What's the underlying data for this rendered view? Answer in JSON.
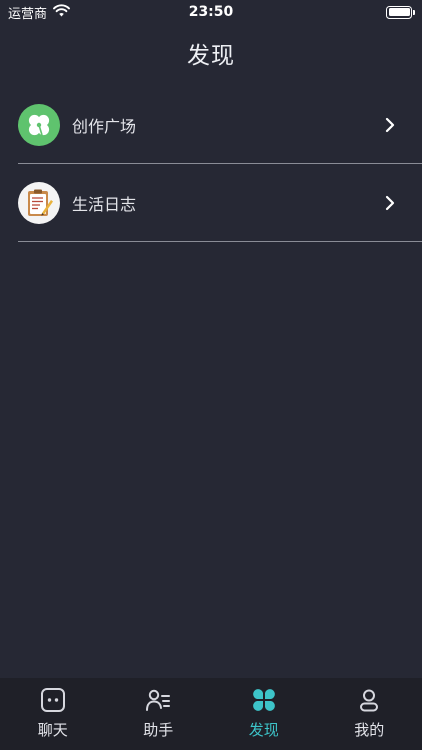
{
  "status_bar": {
    "carrier": "运营商",
    "time": "23:50"
  },
  "header": {
    "title": "发现"
  },
  "list": {
    "items": [
      {
        "label": "创作广场",
        "icon": "clover-icon"
      },
      {
        "label": "生活日志",
        "icon": "clipboard-icon"
      }
    ]
  },
  "tabbar": {
    "tabs": [
      {
        "label": "聊天",
        "icon": "chat-icon"
      },
      {
        "label": "助手",
        "icon": "assistant-icon"
      },
      {
        "label": "发现",
        "icon": "discover-icon"
      },
      {
        "label": "我的",
        "icon": "profile-icon"
      }
    ],
    "active_index": 2
  },
  "colors": {
    "background": "#262834",
    "tabbar_background": "#1f2028",
    "accent": "#3dc4c9",
    "green_avatar": "#5fc36e"
  }
}
